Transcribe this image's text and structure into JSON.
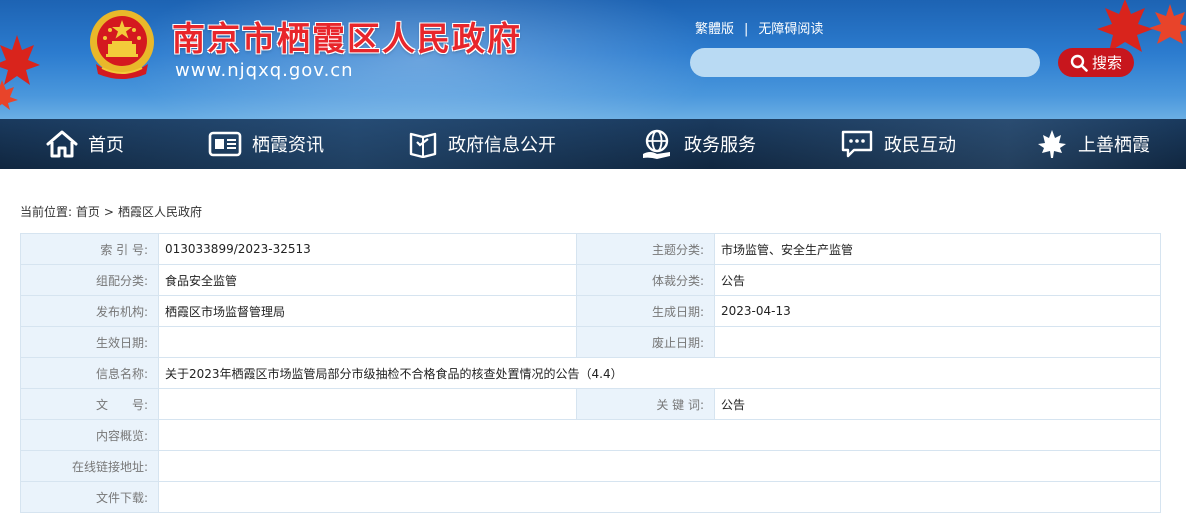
{
  "header": {
    "site_title": "南京市栖霞区人民政府",
    "site_url": "www.njqxq.gov.cn",
    "emblem_icon": "national-emblem-icon",
    "toplinks": {
      "traditional": "繁體版",
      "separator": "|",
      "accessibility": "无障碍阅读"
    },
    "search": {
      "placeholder": "",
      "button_label": "搜索",
      "button_color": "#c8161d"
    },
    "colors": {
      "title": "#e8262b",
      "header_bg": "#2c7ccf"
    }
  },
  "nav": {
    "items": [
      {
        "label": "首页",
        "icon": "home-icon"
      },
      {
        "label": "栖霞资讯",
        "icon": "news-icon"
      },
      {
        "label": "政府信息公开",
        "icon": "open-book-icon"
      },
      {
        "label": "政务服务",
        "icon": "globe-hand-icon"
      },
      {
        "label": "政民互动",
        "icon": "chat-icon"
      },
      {
        "label": "上善栖霞",
        "icon": "maple-leaf-icon"
      }
    ]
  },
  "breadcrumb": {
    "prefix": "当前位置:",
    "home": "首页",
    "sep": ">",
    "current": "栖霞区人民政府"
  },
  "info": {
    "index_label": "索 引 号:",
    "index_value": "013033899/2023-32513",
    "topic_label": "主题分类:",
    "topic_value": "市场监管、安全生产监管",
    "org_class_label": "组配分类:",
    "org_class_value": "食品安全监管",
    "genre_label": "体裁分类:",
    "genre_value": "公告",
    "publisher_label": "发布机构:",
    "publisher_value": "栖霞区市场监督管理局",
    "created_label": "生成日期:",
    "created_value": "2023-04-13",
    "effective_label": "生效日期:",
    "effective_value": "",
    "expired_label": "废止日期:",
    "expired_value": "",
    "name_label": "信息名称:",
    "name_value": "关于2023年栖霞区市场监管局部分市级抽检不合格食品的核查处置情况的公告（4.4）",
    "doc_no_label": "文　　号:",
    "doc_no_value": "",
    "keywords_label": "关 键 词:",
    "keywords_value": "公告",
    "summary_label": "内容概览:",
    "summary_value": "",
    "link_label": "在线链接地址:",
    "link_value": "",
    "download_label": "文件下载:",
    "download_value": ""
  }
}
